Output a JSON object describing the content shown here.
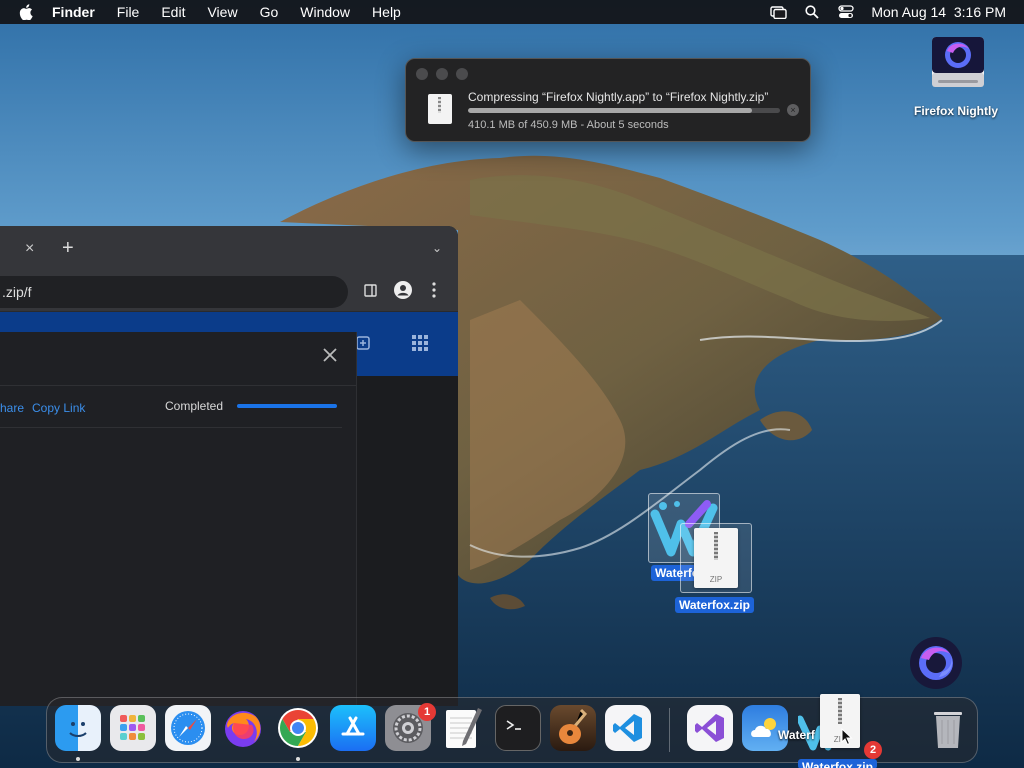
{
  "menubar": {
    "apple_icon": "apple-logo-icon",
    "app_name": "Finder",
    "menus": [
      "File",
      "Edit",
      "View",
      "Go",
      "Window",
      "Help"
    ],
    "status_icons": [
      "screen-mirroring-icon",
      "search-icon",
      "control-center-icon"
    ],
    "clock": "Mon Aug 14  3:16 PM"
  },
  "compress_dialog": {
    "title": "Compressing “Firefox Nightly.app” to “Firefox Nightly.zip”",
    "progress_fraction": 0.909,
    "status": "410.1 MB of 450.9 MB - About 5 seconds"
  },
  "desktop": {
    "icons": [
      {
        "label": "Firefox Nightly",
        "icon": "drive-icon"
      },
      {
        "label": "Waterfox",
        "icon": "waterfox-app-icon",
        "selected": true
      },
      {
        "label": "Waterfox.zip",
        "icon": "zip-file-icon",
        "selected": true
      }
    ]
  },
  "browser": {
    "tab_close": "×",
    "tab_new": "+",
    "tab_menu_icon": "chevron-down-icon",
    "url": ".zip/f",
    "dialog": {
      "share_link": "hare",
      "copy_link": "Copy Link",
      "status": "Completed",
      "progress_fraction": 1.0
    }
  },
  "dock": {
    "apps": [
      {
        "name": "Finder",
        "running": true
      },
      {
        "name": "Launchpad",
        "running": false
      },
      {
        "name": "Safari",
        "running": false
      },
      {
        "name": "Firefox",
        "running": false
      },
      {
        "name": "Google Chrome",
        "running": true
      },
      {
        "name": "App Store",
        "running": false
      },
      {
        "name": "System Settings",
        "running": false,
        "badge": "1"
      },
      {
        "name": "TextEdit",
        "running": false
      },
      {
        "name": "Terminal",
        "running": false
      },
      {
        "name": "GarageBand",
        "running": false
      },
      {
        "name": "Visual Studio Code",
        "running": false
      },
      {
        "name": "Visual Studio",
        "running": false
      },
      {
        "name": "Weather",
        "running": false
      },
      {
        "name": "Downloads",
        "running": false,
        "badge": "2"
      },
      {
        "name": "Trash",
        "running": false
      }
    ],
    "drag_label_back": "Waterf",
    "drag_label_front": "Waterfox.zip"
  },
  "colors": {
    "selection_blue": "#1d63d8",
    "link_blue": "#3b8eea",
    "badge_red": "#e53935"
  }
}
